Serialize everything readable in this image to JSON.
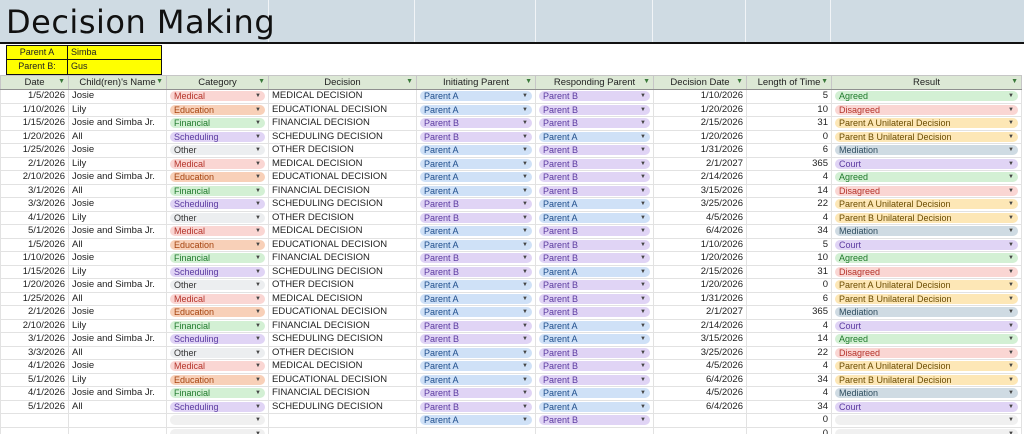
{
  "title": "Decision Making",
  "parents": [
    {
      "label": "Parent A",
      "name": "Simba"
    },
    {
      "label": "Parent B:",
      "name": "Gus"
    }
  ],
  "headers": [
    "Date",
    "Child(ren)'s Name",
    "Category",
    "Decision",
    "Initiating Parent",
    "Responding Parent",
    "Decision Date",
    "Length of Time",
    "Result"
  ],
  "rows": [
    [
      "1/5/2026",
      "Josie",
      "Medical",
      "MEDICAL DECISION",
      "Parent A",
      "Parent B",
      "1/10/2026",
      "5",
      "Agreed"
    ],
    [
      "1/10/2026",
      "Lily",
      "Education",
      "EDUCATIONAL DECISION",
      "Parent A",
      "Parent B",
      "1/20/2026",
      "10",
      "Disagreed"
    ],
    [
      "1/15/2026",
      "Josie and Simba Jr.",
      "Financial",
      "FINANCIAL DECISION",
      "Parent B",
      "Parent B",
      "2/15/2026",
      "31",
      "Parent A Unilateral Decision"
    ],
    [
      "1/20/2026",
      "All",
      "Scheduling",
      "SCHEDULING DECISION",
      "Parent B",
      "Parent A",
      "1/20/2026",
      "0",
      "Parent B Unilateral Decision"
    ],
    [
      "1/25/2026",
      "Josie",
      "Other",
      "OTHER DECISION",
      "Parent A",
      "Parent B",
      "1/31/2026",
      "6",
      "Mediation"
    ],
    [
      "2/1/2026",
      "Lily",
      "Medical",
      "MEDICAL DECISION",
      "Parent A",
      "Parent B",
      "2/1/2027",
      "365",
      "Court"
    ],
    [
      "2/10/2026",
      "Josie and Simba Jr.",
      "Education",
      "EDUCATIONAL DECISION",
      "Parent A",
      "Parent B",
      "2/14/2026",
      "4",
      "Agreed"
    ],
    [
      "3/1/2026",
      "All",
      "Financial",
      "FINANCIAL DECISION",
      "Parent A",
      "Parent B",
      "3/15/2026",
      "14",
      "Disagreed"
    ],
    [
      "3/3/2026",
      "Josie",
      "Scheduling",
      "SCHEDULING DECISION",
      "Parent B",
      "Parent A",
      "3/25/2026",
      "22",
      "Parent A Unilateral Decision"
    ],
    [
      "4/1/2026",
      "Lily",
      "Other",
      "OTHER DECISION",
      "Parent B",
      "Parent A",
      "4/5/2026",
      "4",
      "Parent B Unilateral Decision"
    ],
    [
      "5/1/2026",
      "Josie and Simba Jr.",
      "Medical",
      "MEDICAL DECISION",
      "Parent A",
      "Parent B",
      "6/4/2026",
      "34",
      "Mediation"
    ],
    [
      "1/5/2026",
      "All",
      "Education",
      "EDUCATIONAL DECISION",
      "Parent A",
      "Parent B",
      "1/10/2026",
      "5",
      "Court"
    ],
    [
      "1/10/2026",
      "Josie",
      "Financial",
      "FINANCIAL DECISION",
      "Parent B",
      "Parent B",
      "1/20/2026",
      "10",
      "Agreed"
    ],
    [
      "1/15/2026",
      "Lily",
      "Scheduling",
      "SCHEDULING DECISION",
      "Parent B",
      "Parent A",
      "2/15/2026",
      "31",
      "Disagreed"
    ],
    [
      "1/20/2026",
      "Josie and Simba Jr.",
      "Other",
      "OTHER DECISION",
      "Parent A",
      "Parent B",
      "1/20/2026",
      "0",
      "Parent A Unilateral Decision"
    ],
    [
      "1/25/2026",
      "All",
      "Medical",
      "MEDICAL DECISION",
      "Parent A",
      "Parent B",
      "1/31/2026",
      "6",
      "Parent B Unilateral Decision"
    ],
    [
      "2/1/2026",
      "Josie",
      "Education",
      "EDUCATIONAL DECISION",
      "Parent A",
      "Parent B",
      "2/1/2027",
      "365",
      "Mediation"
    ],
    [
      "2/10/2026",
      "Lily",
      "Financial",
      "FINANCIAL DECISION",
      "Parent B",
      "Parent A",
      "2/14/2026",
      "4",
      "Court"
    ],
    [
      "3/1/2026",
      "Josie and Simba Jr.",
      "Scheduling",
      "SCHEDULING DECISION",
      "Parent B",
      "Parent A",
      "3/15/2026",
      "14",
      "Agreed"
    ],
    [
      "3/3/2026",
      "All",
      "Other",
      "OTHER DECISION",
      "Parent A",
      "Parent B",
      "3/25/2026",
      "22",
      "Disagreed"
    ],
    [
      "4/1/2026",
      "Josie",
      "Medical",
      "MEDICAL DECISION",
      "Parent A",
      "Parent B",
      "4/5/2026",
      "4",
      "Parent A Unilateral Decision"
    ],
    [
      "5/1/2026",
      "Lily",
      "Education",
      "EDUCATIONAL DECISION",
      "Parent A",
      "Parent B",
      "6/4/2026",
      "34",
      "Parent B Unilateral Decision"
    ],
    [
      "4/1/2026",
      "Josie and Simba Jr.",
      "Financial",
      "FINANCIAL DECISION",
      "Parent B",
      "Parent A",
      "4/5/2026",
      "4",
      "Mediation"
    ],
    [
      "5/1/2026",
      "All",
      "Scheduling",
      "SCHEDULING DECISION",
      "Parent B",
      "Parent A",
      "6/4/2026",
      "34",
      "Court"
    ],
    [
      "",
      "",
      "",
      "",
      "Parent A",
      "Parent B",
      "",
      "0",
      ""
    ],
    [
      "",
      "",
      "",
      "",
      "",
      "",
      "",
      "0",
      ""
    ]
  ],
  "colors": {
    "title_bg": "#cfdbe3",
    "param_bg": "#ffff00",
    "header_bg": "#dce8d5"
  },
  "icons": {
    "filter": "filter-icon",
    "dropdown": "dropdown-arrow-icon"
  }
}
